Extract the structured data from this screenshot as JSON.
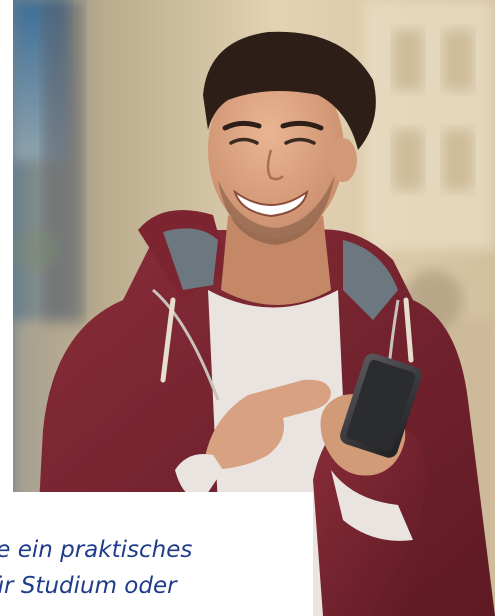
{
  "photo": {
    "subject": "smiling-man-with-smartphone",
    "colors": {
      "jacket": "#7a2530",
      "shirt": "#e9e4df",
      "background": "#d7c4a4",
      "caption": "#1e3c8a"
    }
  },
  "caption": {
    "line1": "chte ein praktisches",
    "line2": "o für Studium oder"
  }
}
